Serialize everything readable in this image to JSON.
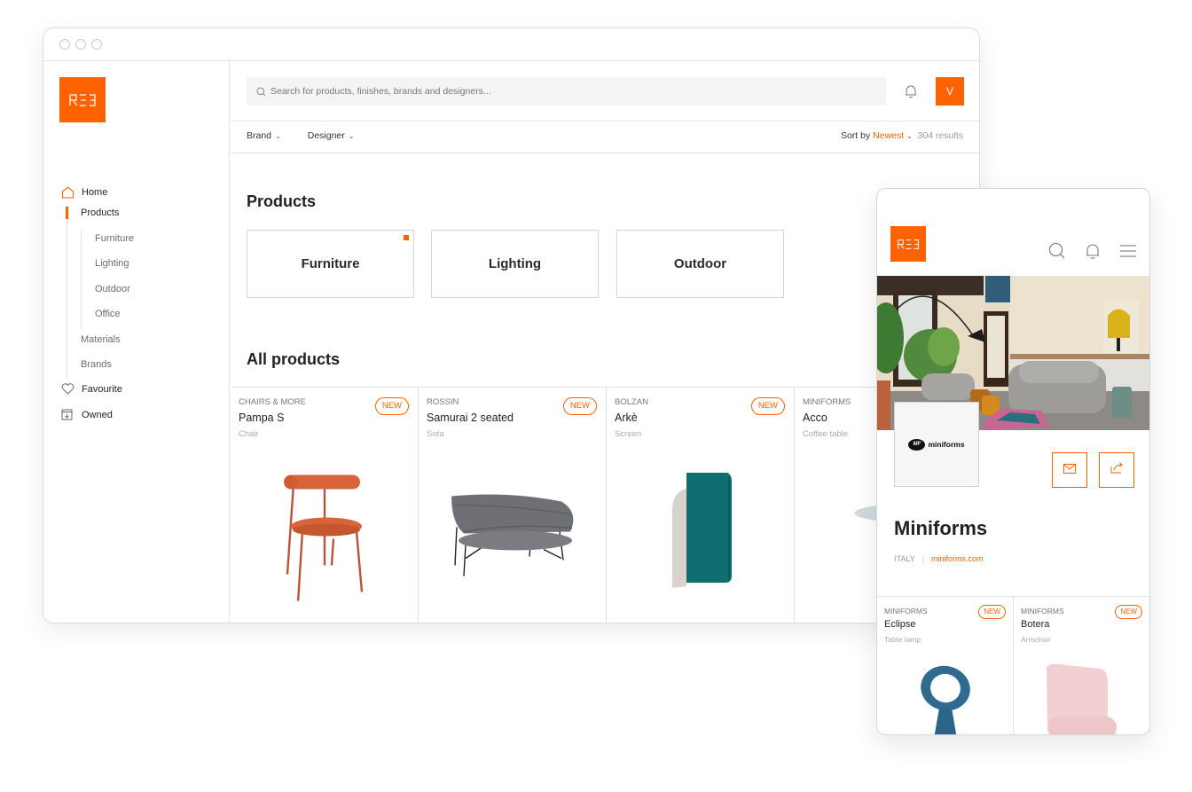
{
  "colors": {
    "accent": "#ff6200",
    "border": "#e2e2e2",
    "muted_text": "#9a9a9a"
  },
  "logo": {
    "text": "REI",
    "icon": "brand-logo"
  },
  "sidebar": {
    "items": [
      {
        "label": "Home",
        "icon": "home-icon"
      },
      {
        "label": "Products",
        "active": true
      },
      {
        "label": "Furniture",
        "sub": true
      },
      {
        "label": "Lighting",
        "sub": true
      },
      {
        "label": "Outdoor",
        "sub": true
      },
      {
        "label": "Office",
        "sub": true
      },
      {
        "label": "Materials"
      },
      {
        "label": "Brands"
      },
      {
        "label": "Favourite",
        "icon": "heart-icon"
      },
      {
        "label": "Owned",
        "icon": "download-box-icon"
      }
    ]
  },
  "header": {
    "search_placeholder": "Search for products, finishes, brands and designers...",
    "avatar_initial": "V",
    "notification_icon": "bell-icon"
  },
  "filters": {
    "brand_label": "Brand",
    "designer_label": "Designer",
    "sort_prefix": "Sort by",
    "sort_value": "Newest",
    "results": "304 results"
  },
  "products_section": {
    "title": "Products",
    "categories": [
      {
        "label": "Furniture",
        "marked": true
      },
      {
        "label": "Lighting"
      },
      {
        "label": "Outdoor"
      }
    ]
  },
  "all_products": {
    "title": "All products",
    "items": [
      {
        "brand": "CHAIRS & MORE",
        "name": "Pampa S",
        "type": "Chair",
        "badge": "NEW"
      },
      {
        "brand": "ROSSIN",
        "name": "Samurai 2 seated",
        "type": "Sofa",
        "badge": "NEW"
      },
      {
        "brand": "BOLZAN",
        "name": "Arkè",
        "type": "Screen",
        "badge": "NEW"
      },
      {
        "brand": "MINIFORMS",
        "name": "Acco",
        "type": "Coffee table",
        "badge": ""
      }
    ]
  },
  "mobile": {
    "icons": [
      "search-icon",
      "bell-icon",
      "menu-icon"
    ],
    "brand_logo_text": "miniforms",
    "brand_name": "Miniforms",
    "country": "ITALY",
    "website": "miniforms.com",
    "actions": [
      "mail-icon",
      "share-icon"
    ],
    "items": [
      {
        "brand": "MINIFORMS",
        "name": "Eclipse",
        "type": "Table lamp",
        "badge": "NEW"
      },
      {
        "brand": "MINIFORMS",
        "name": "Botera",
        "type": "Armchair",
        "badge": "NEW"
      }
    ]
  }
}
